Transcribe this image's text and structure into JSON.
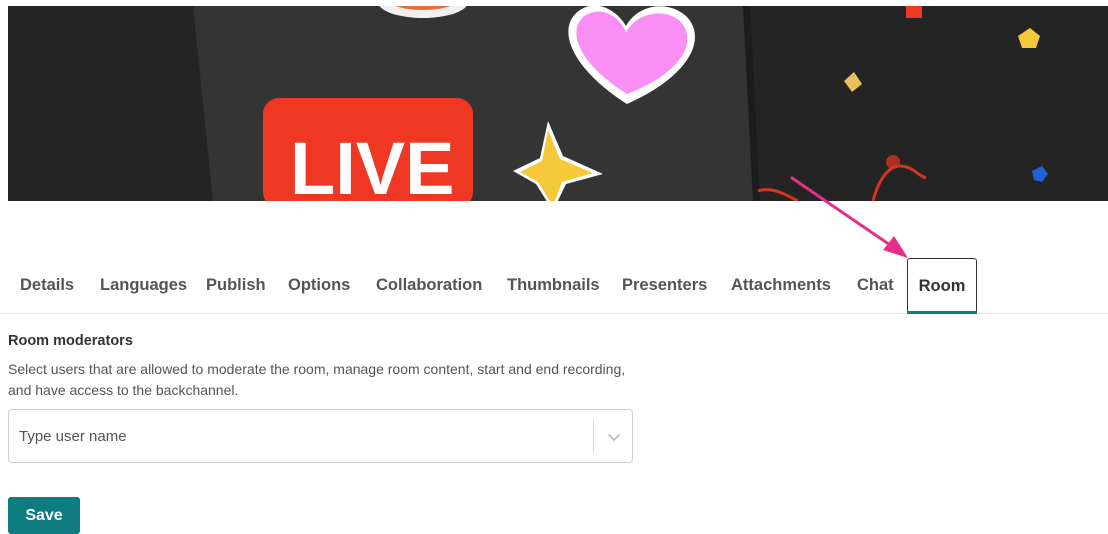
{
  "banner": {
    "live_text": "LIVE",
    "colors": {
      "background": "#242424",
      "phone": "#333333",
      "live_red": "#ee3824",
      "heart_pink": "#f98ff5",
      "star_yellow": "#f5c93a"
    }
  },
  "tabs": [
    {
      "label": "Details",
      "active": false
    },
    {
      "label": "Languages",
      "active": false
    },
    {
      "label": "Publish",
      "active": false
    },
    {
      "label": "Options",
      "active": false
    },
    {
      "label": "Collaboration",
      "active": false
    },
    {
      "label": "Thumbnails",
      "active": false
    },
    {
      "label": "Presenters",
      "active": false
    },
    {
      "label": "Attachments",
      "active": false
    },
    {
      "label": "Chat",
      "active": false
    },
    {
      "label": "Room",
      "active": true
    }
  ],
  "room": {
    "title": "Room moderators",
    "description": "Select users that are allowed to moderate the room, manage room content, start and end recording, and have access to the backchannel.",
    "select": {
      "placeholder": "Type user name",
      "value": ""
    }
  },
  "actions": {
    "save_label": "Save"
  },
  "colors": {
    "accent": "#0d7b80",
    "annotation_arrow": "#e5308a"
  },
  "annotation": {
    "icon": "pink-arrow-icon"
  }
}
